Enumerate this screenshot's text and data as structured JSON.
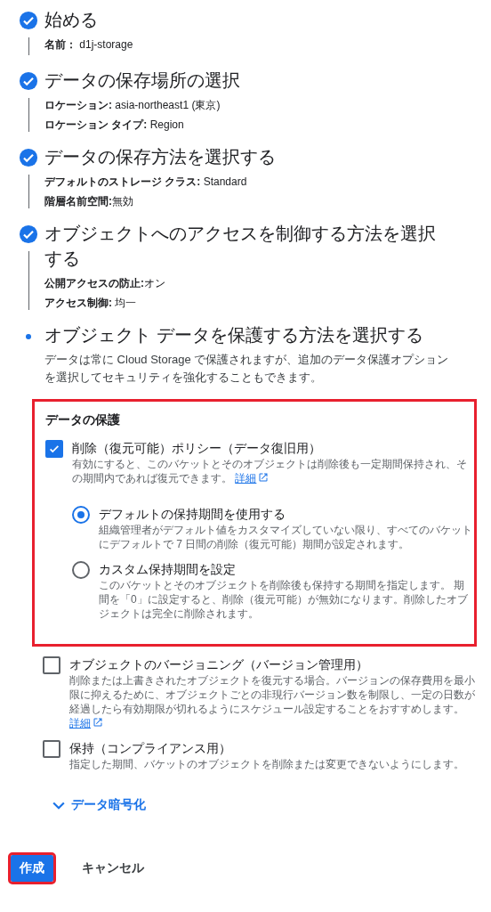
{
  "steps": [
    {
      "title": "始める",
      "completed": true,
      "details": [
        "**名前：** d1j-storage"
      ]
    },
    {
      "title": "データの保存場所の選択",
      "completed": true,
      "details": [
        "**ロケーション:** asia-northeast1 (東京)",
        "**ロケーション タイプ:** Region"
      ]
    },
    {
      "title": "データの保存方法を選択する",
      "completed": true,
      "details": [
        "**デフォルトのストレージ クラス:** Standard",
        "**階層名前空間:**無効"
      ]
    },
    {
      "title": "オブジェクトへのアクセスを制御する方法を選択する",
      "completed": true,
      "details": [
        "**公開アクセスの防止:**オン",
        "**アクセス制御:** 均一"
      ]
    },
    {
      "title": "オブジェクト データを保護する方法を選択する",
      "completed": false,
      "description": "データは常に Cloud Storage で保護されますが、追加のデータ保護オプションを選択してセキュリティを強化することもできます。"
    }
  ],
  "protection": {
    "heading": "データの保護",
    "highlighted": true,
    "soft_delete": {
      "label": "削除（復元可能）ポリシー（データ復旧用）",
      "checked": true,
      "description": "有効にすると、このバケットとそのオブジェクトは削除後も一定期間保持され、その期間内であれば復元できます。",
      "link": "詳細",
      "options": [
        {
          "label": "デフォルトの保持期間を使用する",
          "selected": true,
          "description": "組織管理者がデフォルト値をカスタマイズしていない限り、すべてのバケットにデフォルトで 7 日間の削除（復元可能）期間が設定されます。"
        },
        {
          "label": "カスタム保持期間を設定",
          "selected": false,
          "description": "このバケットとそのオブジェクトを削除後も保持する期間を指定します。 期間を「0」に設定すると、削除（復元可能）が無効になります。削除したオブジェクトは完全に削除されます。"
        }
      ]
    }
  },
  "more_options": [
    {
      "label": "オブジェクトのバージョニング（バージョン管理用）",
      "checked": false,
      "description": "削除または上書きされたオブジェクトを復元する場合。バージョンの保存費用を最小限に抑えるために、オブジェクトごとの非現行バージョン数を制限し、一定の日数が経過したら有効期限が切れるようにスケジュール設定することをおすすめします。",
      "link": "詳細"
    },
    {
      "label": "保持（コンプライアンス用）",
      "checked": false,
      "description": "指定した期間、バケットのオブジェクトを削除または変更できないようにします。"
    }
  ],
  "encryption": {
    "label": "データ暗号化",
    "expanded": false
  },
  "buttons": [
    {
      "label": "作成",
      "kind": "primary",
      "highlighted": true
    },
    {
      "label": "キャンセル",
      "kind": "text",
      "highlighted": false
    }
  ]
}
